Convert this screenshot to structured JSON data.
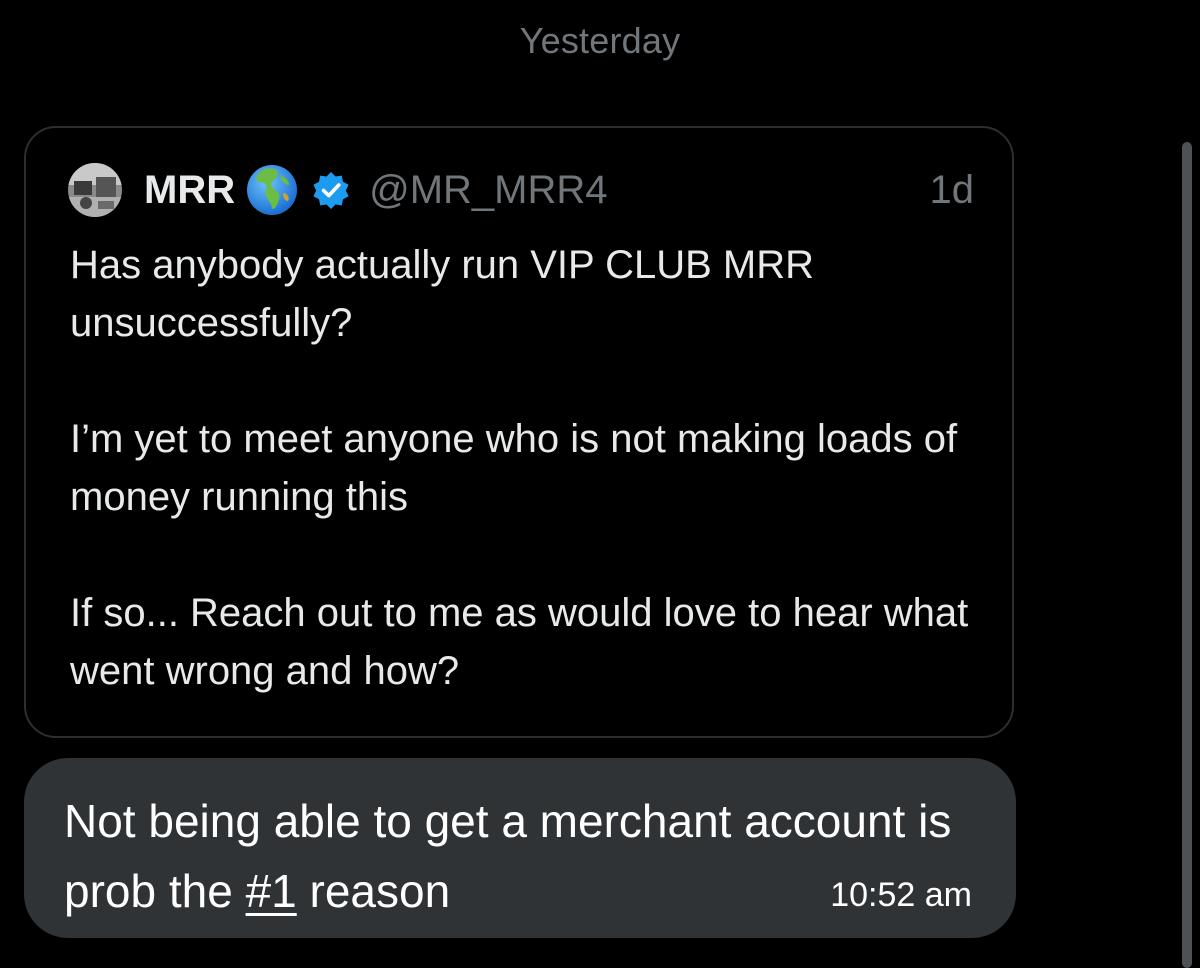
{
  "conversation": {
    "day_divider": "Yesterday"
  },
  "quoted_post": {
    "author": {
      "display_name": "MRR",
      "handle": "@MR_MRR4",
      "badges": [
        "globe-emoji",
        "verified-badge"
      ],
      "verified_color": "#1d9bf0"
    },
    "time_ago": "1d",
    "text": "Has anybody actually run VIP CLUB MRR unsuccessfully?\n\nI’m yet to meet anyone who is not making loads of money running this\n\nIf so... Reach out to me as would love to hear what went wrong and how?"
  },
  "message": {
    "text_before": "Not being able to get a merchant account is prob the ",
    "hashtag": "#1",
    "text_after": " reason",
    "timestamp": "10:52 am",
    "bubble_color": "#2f3336"
  },
  "colors": {
    "background": "#000000",
    "secondary_text": "#71767b",
    "primary_text": "#e7e9ea"
  }
}
